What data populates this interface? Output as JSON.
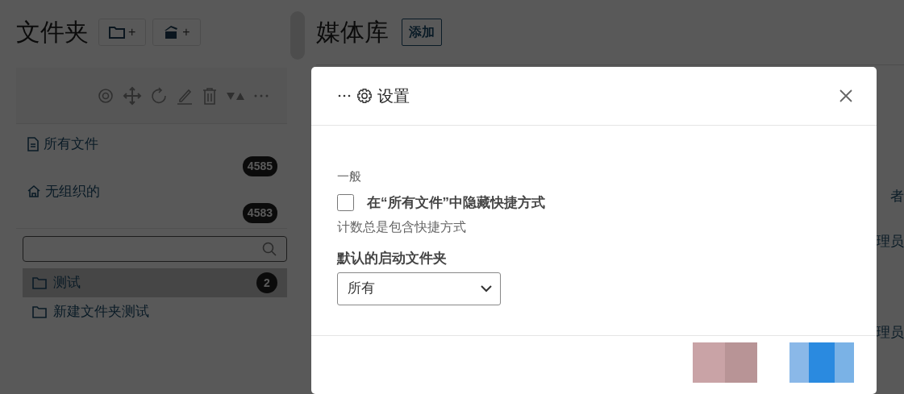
{
  "sidebar": {
    "title": "文件夹",
    "add_buttons": [
      {
        "label": "+",
        "kind": "folder"
      },
      {
        "label": "+",
        "kind": "box"
      }
    ],
    "pinned": [
      {
        "label": "所有文件",
        "count": "4585",
        "kind": "file"
      },
      {
        "label": "无组织的",
        "count": "4583",
        "kind": "home"
      }
    ],
    "folders": [
      {
        "label": "测试",
        "count": "2",
        "selected": true
      },
      {
        "label": "新建文件夹测试",
        "selected": false
      }
    ]
  },
  "main": {
    "title": "媒体库",
    "add_button": "添加",
    "table": {
      "column_1": "者",
      "cells": [
        "理员",
        "理员"
      ]
    }
  },
  "modal": {
    "title": "设置",
    "section": "一般",
    "checkbox": {
      "label": "在“所有文件”中隐藏快捷方式",
      "checked": false
    },
    "help": "计数总是包含快捷方式",
    "select_label": "默认的启动文件夹",
    "select_value": "所有"
  }
}
